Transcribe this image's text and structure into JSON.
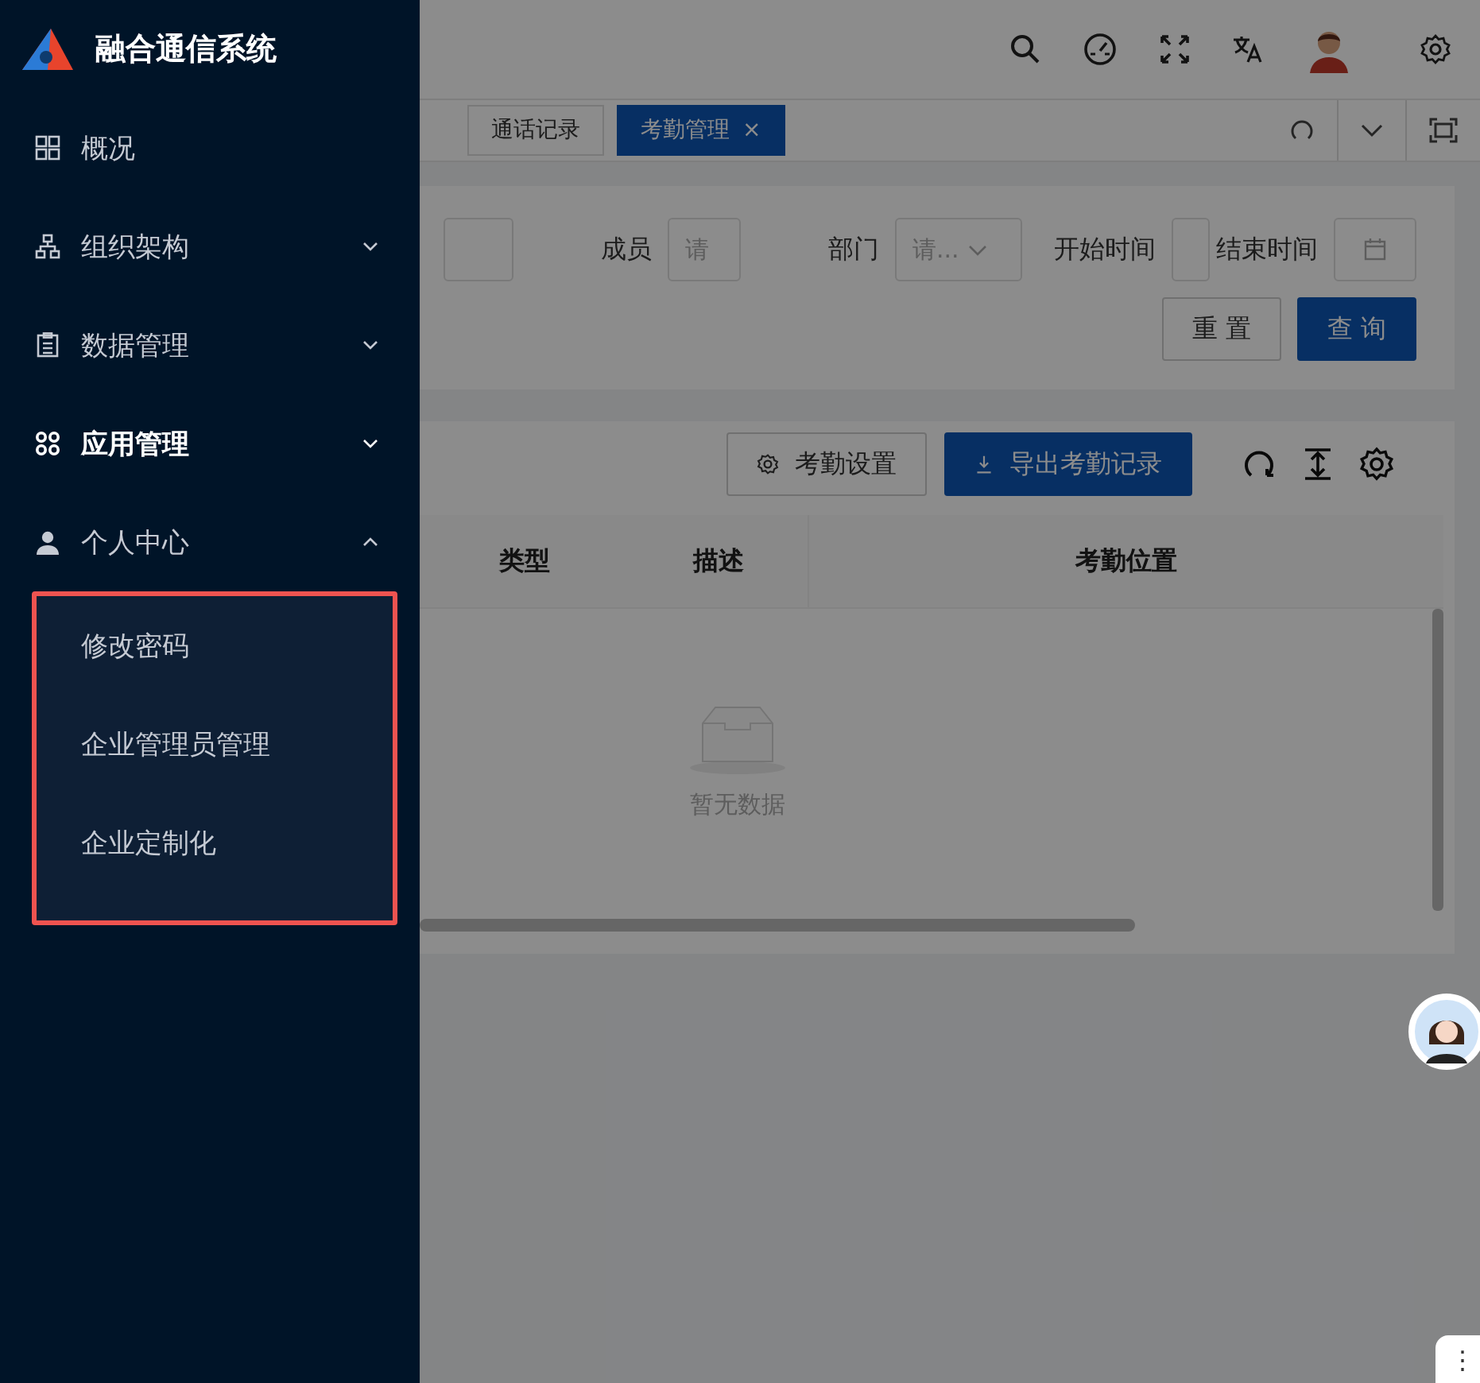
{
  "app": {
    "title": "融合通信系统"
  },
  "sidebar": {
    "items": [
      {
        "label": "概况",
        "has_submenu": false,
        "emphasized": false
      },
      {
        "label": "组织架构",
        "has_submenu": true,
        "expanded": false,
        "emphasized": false
      },
      {
        "label": "数据管理",
        "has_submenu": true,
        "expanded": false,
        "emphasized": false
      },
      {
        "label": "应用管理",
        "has_submenu": true,
        "expanded": false,
        "emphasized": true
      },
      {
        "label": "个人中心",
        "has_submenu": true,
        "expanded": true,
        "emphasized": false,
        "highlighted": true,
        "children": [
          {
            "label": "修改密码"
          },
          {
            "label": "企业管理员管理"
          },
          {
            "label": "企业定制化"
          }
        ]
      }
    ]
  },
  "tabs": [
    {
      "label": "通话记录",
      "selected": false
    },
    {
      "label": "考勤管理",
      "selected": true,
      "close": "×"
    }
  ],
  "filters": [
    {
      "kind": "text"
    },
    {
      "kind": "text",
      "label": "成员",
      "placeholder": "请"
    },
    {
      "kind": "select",
      "label": "部门",
      "placeholder": "请..."
    },
    {
      "kind": "date",
      "label": "开始时间"
    },
    {
      "kind": "date",
      "label": "结束时间"
    }
  ],
  "filter_buttons": [
    {
      "label": "重 置",
      "primary": false
    },
    {
      "label": "查 询",
      "primary": true
    }
  ],
  "toolbar_buttons": [
    {
      "label": "考勤设置",
      "primary": false
    },
    {
      "label": "导出考勤记录",
      "primary": true
    }
  ],
  "table": {
    "columns": [
      "类型",
      "描述",
      "考勤位置"
    ],
    "empty_text": "暂无数据"
  },
  "more_button": {
    "label": "⋮"
  }
}
